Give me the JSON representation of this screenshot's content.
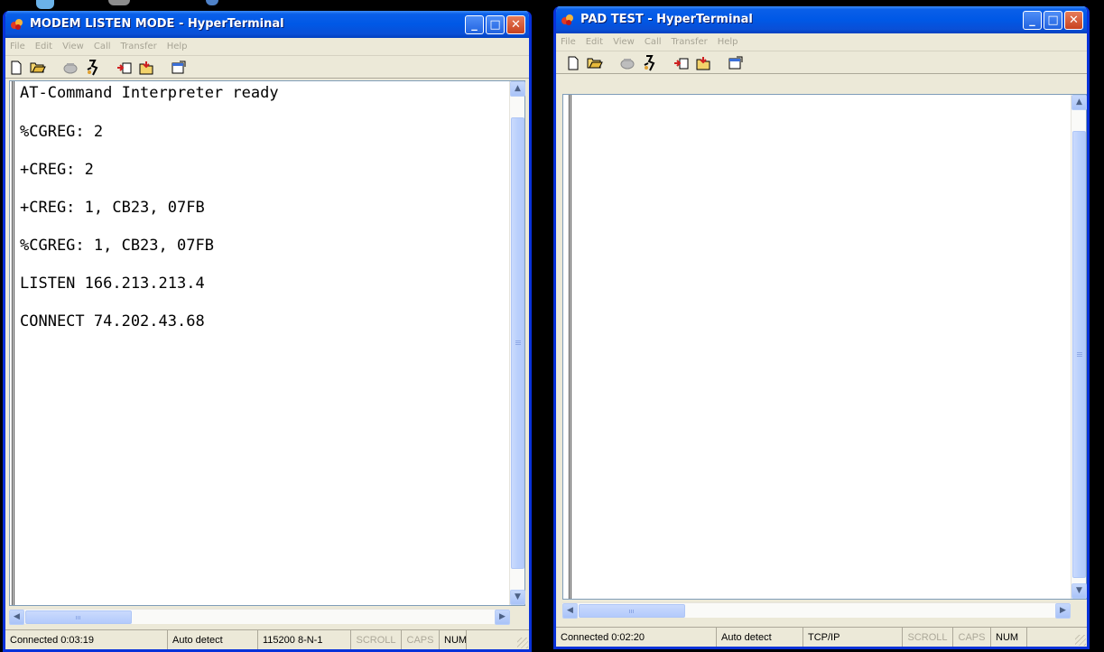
{
  "colors": {
    "titlebar": "#0058E6",
    "window_frame": "#0831D9",
    "window_body": "#ECE9D8",
    "terminal_bg": "#FFFFFF",
    "terminal_text": "#000000",
    "disabled_text": "#ACA899"
  },
  "left_window": {
    "title": "MODEM LISTEN MODE - HyperTerminal",
    "menu": [
      "File",
      "Edit",
      "View",
      "Call",
      "Transfer",
      "Help"
    ],
    "terminal_lines": [
      "AT-Command Interpreter ready",
      "%CGREG: 2",
      "+CREG: 2",
      "+CREG: 1, CB23, 07FB",
      "%CGREG: 1, CB23, 07FB",
      "LISTEN 166.213.213.4",
      "CONNECT 74.202.43.68"
    ],
    "status": {
      "connected": "Connected 0:03:19",
      "detect": "Auto detect",
      "settings": "115200 8-N-1",
      "scroll": "SCROLL",
      "caps": "CAPS",
      "num": "NUM"
    }
  },
  "right_window": {
    "title": "PAD TEST - HyperTerminal",
    "menu": [
      "File",
      "Edit",
      "View",
      "Call",
      "Transfer",
      "Help"
    ],
    "terminal_lines": [],
    "status": {
      "connected": "Connected 0:02:20",
      "detect": "Auto detect",
      "settings": "TCP/IP",
      "scroll": "SCROLL",
      "caps": "CAPS",
      "num": "NUM"
    }
  },
  "title_buttons": {
    "minimize": "_",
    "maximize": "□",
    "close": "✕"
  },
  "scroll_glyphs": {
    "up": "▲",
    "down": "▼",
    "left": "◀",
    "right": "▶"
  },
  "icons": [
    "new-icon",
    "open-icon",
    "call-icon",
    "disconnect-icon",
    "send-icon",
    "receive-icon",
    "properties-icon"
  ]
}
